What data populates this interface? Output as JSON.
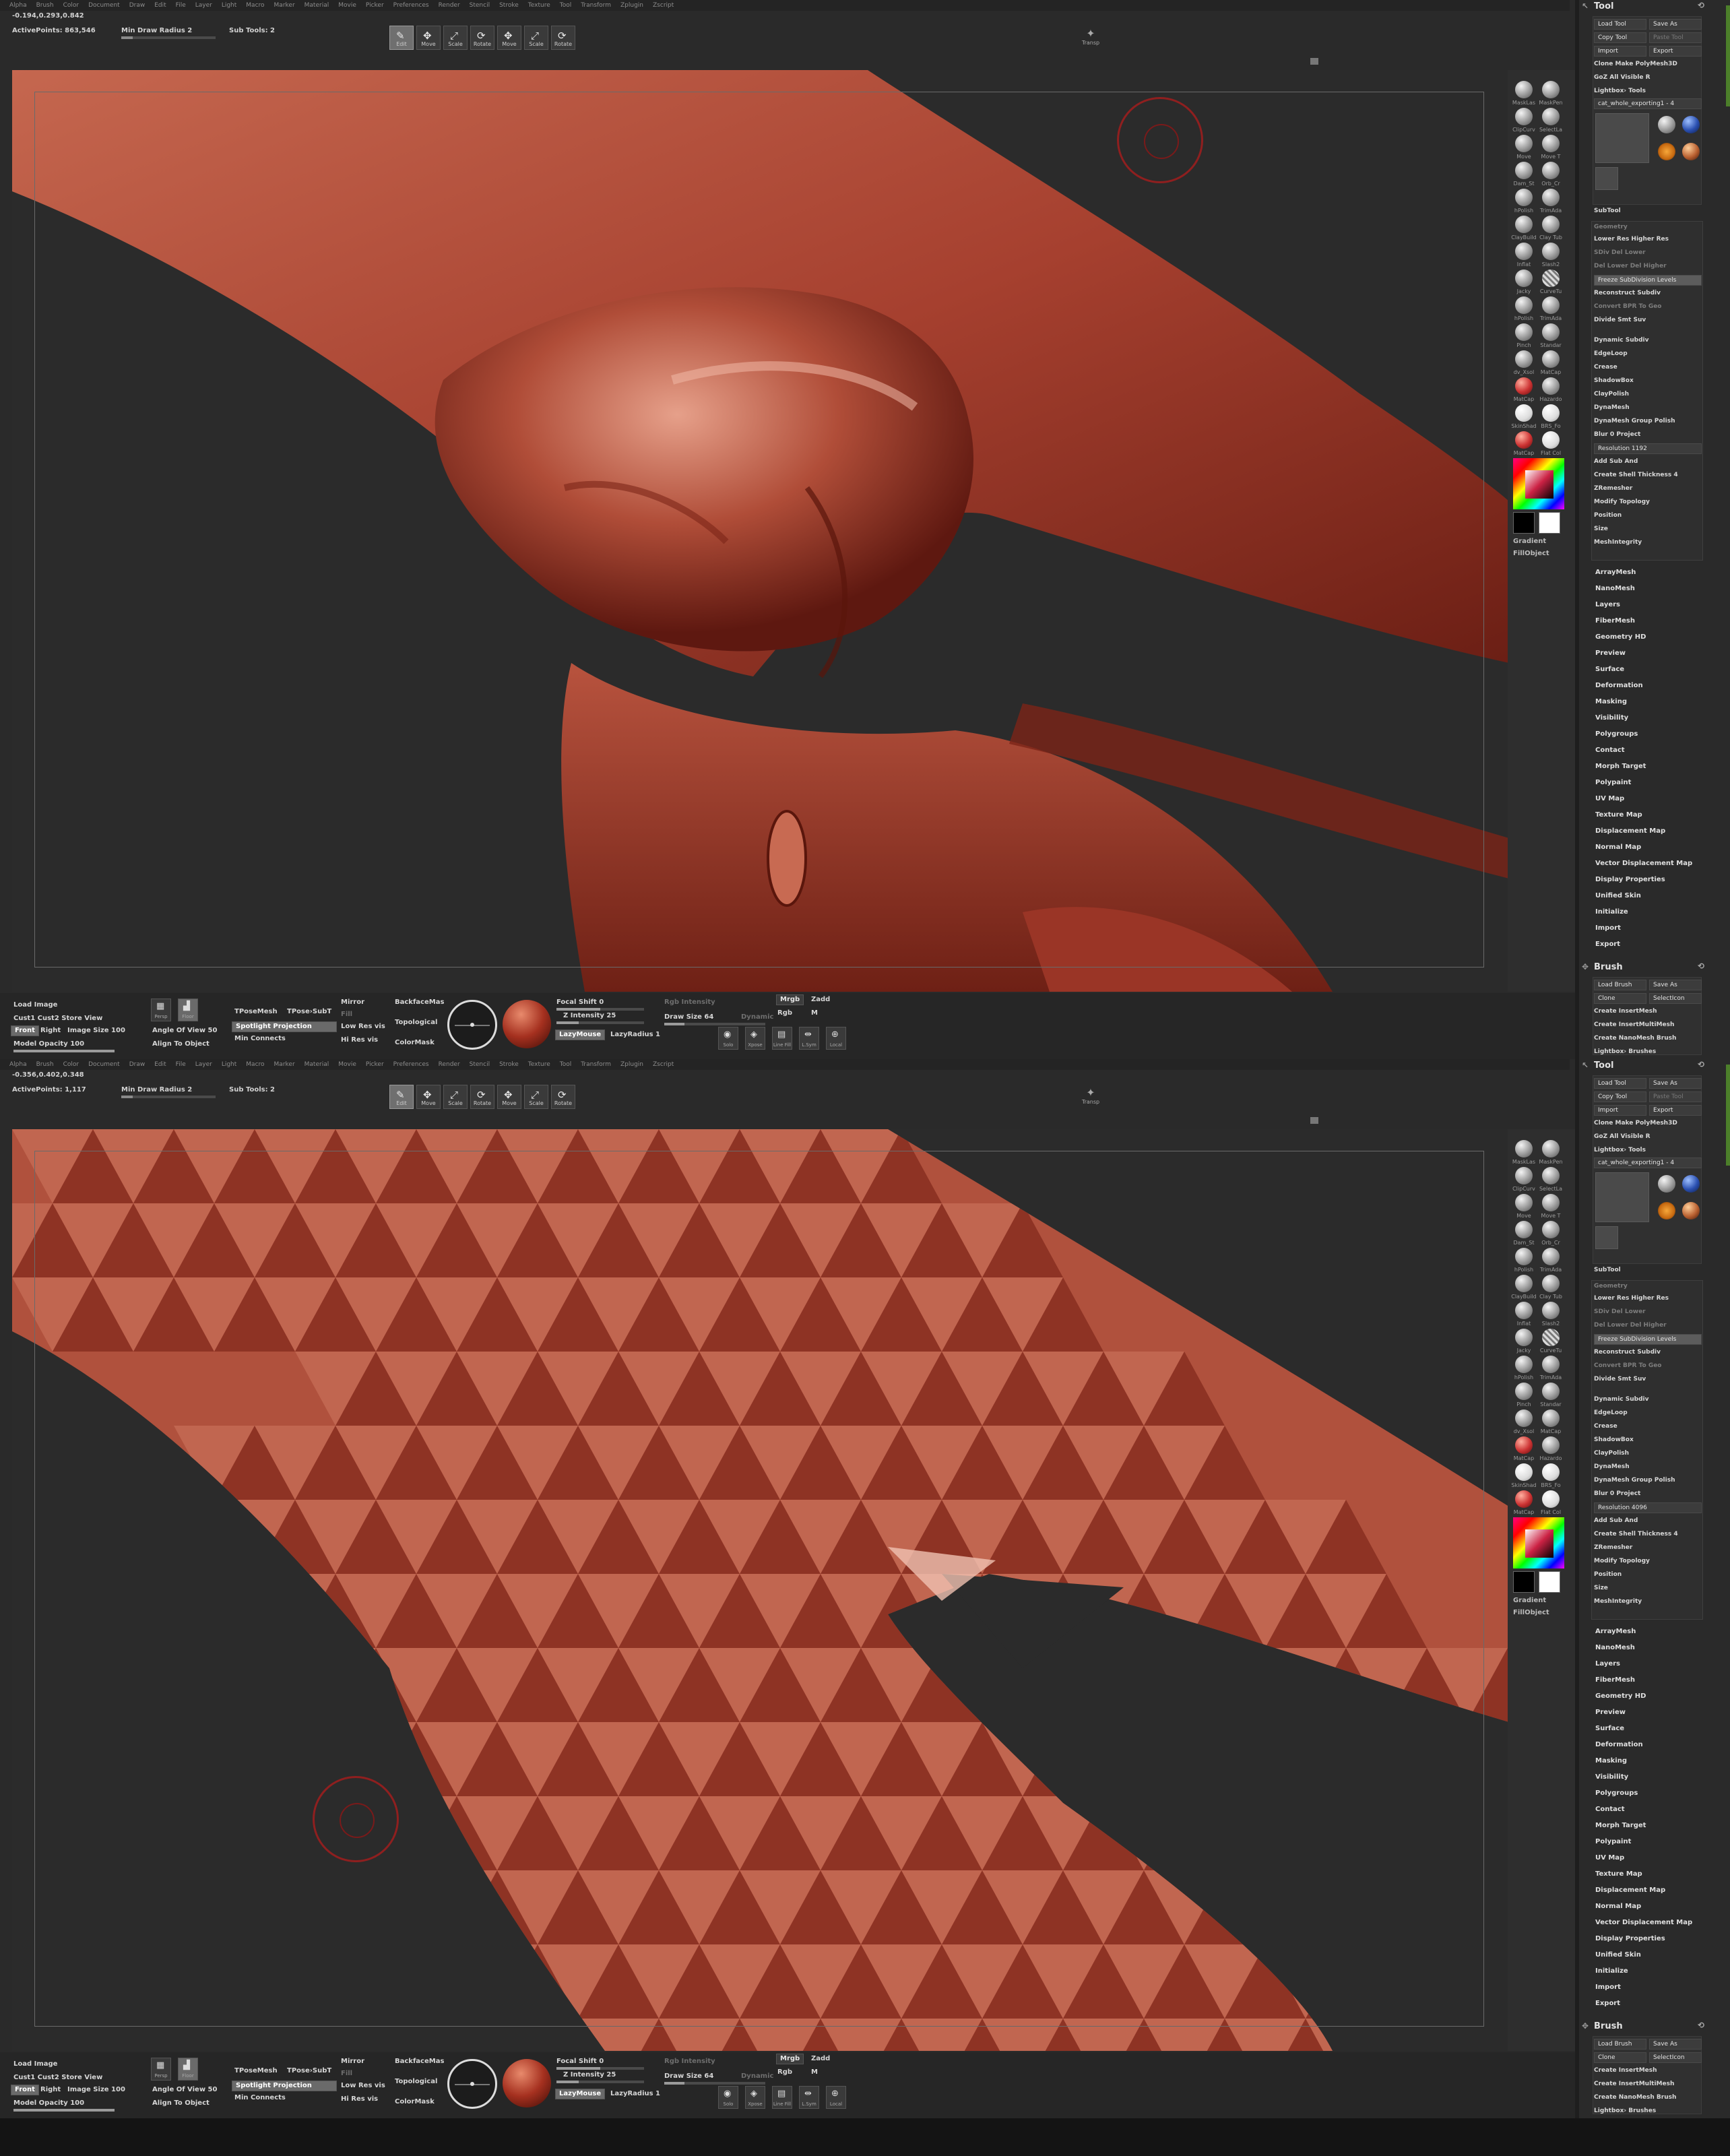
{
  "menu": [
    "Alpha",
    "Brush",
    "Color",
    "Document",
    "Draw",
    "Edit",
    "File",
    "Layer",
    "Light",
    "Macro",
    "Marker",
    "Material",
    "Movie",
    "Picker",
    "Preferences",
    "Render",
    "Stencil",
    "Stroke",
    "Texture",
    "Tool",
    "Transform",
    "Zplugin",
    "Zscript"
  ],
  "toolbar": {
    "min_draw_radius": "Min Draw Radius 2",
    "sub_tools": "Sub Tools: 2",
    "buttons": [
      {
        "label": "Edit",
        "glyph": "✎",
        "active": true
      },
      {
        "label": "Move",
        "glyph": "✥",
        "active": false
      },
      {
        "label": "Scale",
        "glyph": "⤢",
        "active": false
      },
      {
        "label": "Rotate",
        "glyph": "⟳",
        "active": false
      },
      {
        "label": "Move",
        "glyph": "✥",
        "active": false
      },
      {
        "label": "Scale",
        "glyph": "⤢",
        "active": false
      },
      {
        "label": "Rotate",
        "glyph": "⟳",
        "active": false
      }
    ],
    "transp_label": "Transp",
    "transp_glyph": "✦"
  },
  "panels": [
    {
      "coords": "-0.194,0.293,0.842",
      "active_points": "ActivePoints: 863,546",
      "resolution": "Resolution 1192"
    },
    {
      "coords": "-0.356,0.402,0.348",
      "active_points": "ActivePoints: 1,117",
      "resolution": "Resolution 4096"
    }
  ],
  "shelf": {
    "brushes": [
      {
        "label": "MaskLas",
        "kind": "plain"
      },
      {
        "label": "MaskPen",
        "kind": "plain"
      },
      {
        "label": "ClipCurv",
        "kind": "plain"
      },
      {
        "label": "SelectLa",
        "kind": "plain"
      },
      {
        "label": "Move",
        "kind": "plain"
      },
      {
        "label": "Move T",
        "kind": "plain"
      },
      {
        "label": "Dam_St",
        "kind": "plain"
      },
      {
        "label": "Orb_Cr",
        "kind": "plain"
      },
      {
        "label": "hPolish",
        "kind": "plain"
      },
      {
        "label": "TrimAda",
        "kind": "plain"
      },
      {
        "label": "ClayBuild",
        "kind": "plain"
      },
      {
        "label": "Clay Tub",
        "kind": "plain"
      },
      {
        "label": "Inflat",
        "kind": "plain"
      },
      {
        "label": "Slash2",
        "kind": "plain"
      },
      {
        "label": "Jacky",
        "kind": "plain"
      },
      {
        "label": "CurveTu",
        "kind": "hatch"
      },
      {
        "label": "hPolish",
        "kind": "plain"
      },
      {
        "label": "TrimAda",
        "kind": "plain"
      },
      {
        "label": "Pinch",
        "kind": "plain"
      },
      {
        "label": "Standar",
        "kind": "plain"
      },
      {
        "label": "dv_Xsol",
        "kind": "plain"
      },
      {
        "label": "MatCap",
        "kind": "plain"
      },
      {
        "label": "MatCap",
        "kind": "red"
      },
      {
        "label": "Hazardo",
        "kind": "plain"
      },
      {
        "label": "SkinShad",
        "kind": "white"
      },
      {
        "label": "BRS_Fo",
        "kind": "white"
      },
      {
        "label": "MatCap",
        "kind": "red"
      },
      {
        "label": "Flat Col",
        "kind": "white"
      }
    ],
    "gradient_label": "Gradient",
    "fillobject_label": "FillObject"
  },
  "tray": {
    "tool_title": "Tool",
    "tool_buttons": [
      [
        "Load Tool",
        "Save As"
      ],
      [
        "Copy Tool",
        "Paste Tool"
      ],
      [
        "Import",
        "Export"
      ]
    ],
    "clone_row": "Clone   Make PolyMesh3D",
    "goz_row": "GoZ   All   Visible   R",
    "lightbox_tools": "Lightbox› Tools",
    "tool_name": "cat_whole_exporting1 - 4",
    "subtool_label": "SubTool",
    "geometry_label": "Geometry",
    "geometry_rows": [
      {
        "text": "Lower Res   Higher Res",
        "dim": false
      },
      {
        "text": "SDiv   Del Lower",
        "dim": true
      },
      {
        "text": "Del Lower   Del Higher",
        "dim": true
      },
      {
        "text": "Freeze SubDivision Levels",
        "dim": false,
        "hi": true
      },
      {
        "text": "Reconstruct Subdiv",
        "dim": false
      },
      {
        "text": "Convert BPR To Geo",
        "dim": true
      },
      {
        "text": "Divide   Smt  Suv",
        "dim": false
      },
      {
        "text": "Dynamic Subdiv",
        "dim": false
      },
      {
        "text": "EdgeLoop",
        "dim": false
      },
      {
        "text": "Crease",
        "dim": false
      },
      {
        "text": "ShadowBox",
        "dim": false
      },
      {
        "text": "ClayPolish",
        "dim": false
      },
      {
        "text": "DynaMesh",
        "dim": false
      },
      {
        "text": "DynaMesh   Group  Polish",
        "dim": false
      },
      {
        "text": "Blur 0   Project",
        "dim": false
      }
    ],
    "after_res_rows": [
      "Add   Sub   And",
      "Create Shell   Thickness 4",
      "ZRemesher",
      "Modify Topology",
      "Position",
      "Size",
      "MeshIntegrity"
    ],
    "menu_items": [
      "ArrayMesh",
      "NanoMesh",
      "Layers",
      "FiberMesh",
      "Geometry HD",
      "Preview",
      "Surface",
      "Deformation",
      "Masking",
      "Visibility",
      "Polygroups",
      "Contact",
      "Morph Target",
      "Polypaint",
      "UV Map",
      "Texture Map",
      "Displacement Map",
      "Normal Map",
      "Vector Displacement Map",
      "Display Properties",
      "Unified Skin",
      "Initialize",
      "Import",
      "Export"
    ],
    "brush_title": "Brush",
    "brush_rows": [
      [
        "Load Brush",
        "Save As"
      ],
      [
        "Clone",
        "SelectIcon"
      ]
    ],
    "brush_single": [
      "Create InsertMesh",
      "Create InsertMultiMesh",
      "Create NanoMesh Brush",
      "Lightbox› Brushes"
    ]
  },
  "bottom": {
    "load_image": "Load Image",
    "cust_row": "Cust1   Cust2   Store View",
    "front": "Front",
    "right": "Right",
    "image_size": "Image Size 100",
    "model_opacity": "Model Opacity 100",
    "persp": "Persp",
    "floor": "Floor",
    "angle_of_view": "Angle Of View 50",
    "align_to_object": "Align To Object",
    "tposemesh": "TPoseMesh",
    "tpose_subt": "TPose›SubT",
    "spotlight": "Spotlight Projection",
    "min_connects": "Min Connects",
    "mirror": "Mirror",
    "fill": "Fill",
    "low_res": "Low Res vis",
    "hi_res": "Hi Res vis",
    "backface": "BackfaceMas",
    "topological": "Topological",
    "colormask": "ColorMask",
    "focal_shift": "Focal Shift 0",
    "rgb_intensity": "Rgb Intensity",
    "z_intensity": "Z Intensity 25",
    "draw_size": "Draw Size 64",
    "dynamic": "Dynamic",
    "lazymouse": "LazyMouse",
    "lazyradius": "LazyRadius 1",
    "mrgb": "Mrgb",
    "rgb": "Rgb",
    "zadd": "Zadd",
    "zsub": "Zsub",
    "m": "M",
    "small_buttons": [
      "Solo",
      "Xpose",
      "Line Fill",
      "L.Sym",
      "Local"
    ]
  },
  "colors": {
    "clay_base": "#b5523e",
    "clay_dark": "#6a1e14",
    "clay_light": "#e4a38f",
    "background": "#2b2b2b",
    "brush_circle": "#8f1f1f"
  }
}
